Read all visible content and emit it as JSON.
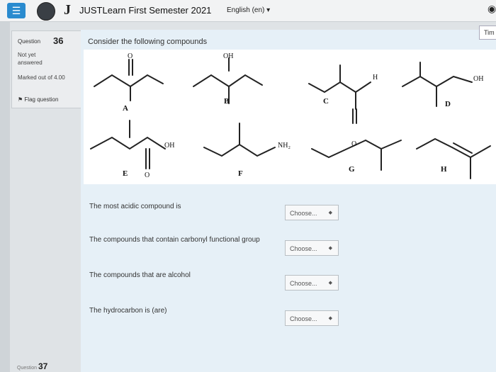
{
  "header": {
    "menu_icon": "hamburger-icon",
    "logo_mark": "J",
    "site_title": "JUSTLearn First Semester 2021",
    "language": "English (en) ▾",
    "notification_icon": "bell-icon"
  },
  "question_info": {
    "label": "Question",
    "number": "36",
    "state": "Not yet answered",
    "marks": "Marked out of 4.00",
    "flag_label": "Ὢ9 Flag question",
    "flag_text": "Flag question"
  },
  "timer_label": "Tim",
  "question": {
    "prompt": "Consider the following compounds",
    "compounds": {
      "labels": [
        "A",
        "B",
        "C",
        "D",
        "E",
        "F",
        "G",
        "H"
      ],
      "groups": [
        "O",
        "OH",
        "H",
        "OH",
        "OH",
        "O",
        "NH₂",
        "O"
      ]
    },
    "sub_questions": [
      {
        "text": "The most acidic compound is",
        "select": "Choose..."
      },
      {
        "text": "The compounds that contain carbonyl functional group",
        "select": "Choose..."
      },
      {
        "text": "The compounds that are alcohol",
        "select": "Choose..."
      },
      {
        "text": "The hydrocarbon is (are)",
        "select": "Choose..."
      }
    ]
  },
  "next_question": {
    "label": "Question",
    "number": "37"
  }
}
